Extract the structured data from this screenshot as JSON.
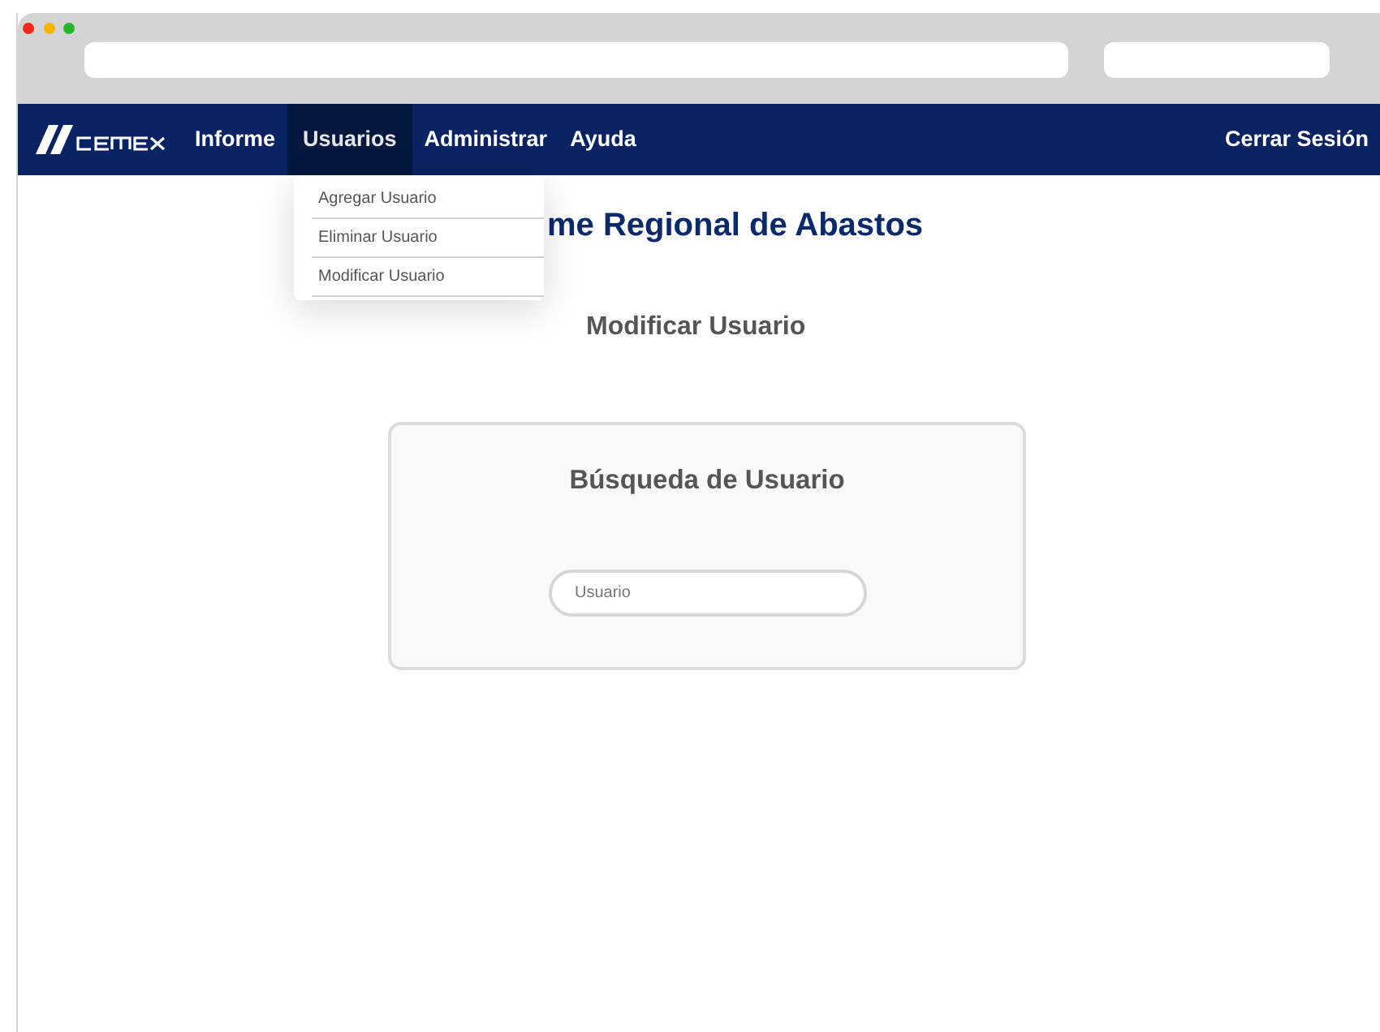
{
  "nav": {
    "items": [
      {
        "label": "Informe",
        "selected": false
      },
      {
        "label": "Usuarios",
        "selected": true
      },
      {
        "label": "Administrar",
        "selected": false
      },
      {
        "label": "Ayuda",
        "selected": false
      }
    ],
    "logout": "Cerrar Sesión"
  },
  "dropdown": {
    "items": [
      "Agregar Usuario",
      "Eliminar Usuario",
      "Modificar Usuario"
    ]
  },
  "page_title": "me Regional de Abastos",
  "subtitle": "Modificar Usuario",
  "search_card": {
    "title": "Búsqueda de Usuario",
    "field": {
      "placeholder": "Usuario"
    }
  }
}
